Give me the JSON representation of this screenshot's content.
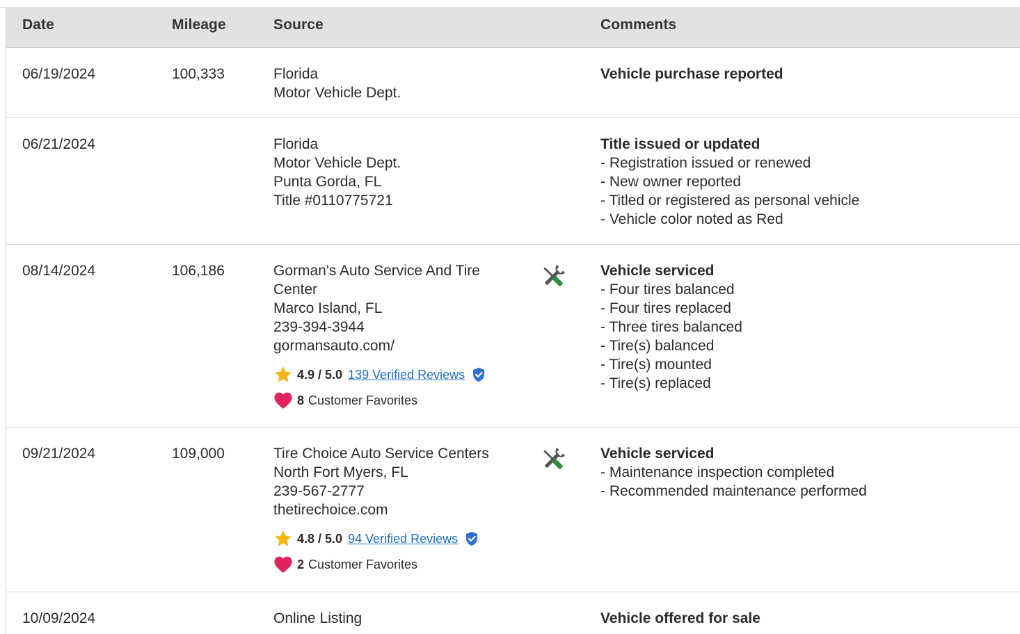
{
  "table": {
    "headers": {
      "date": "Date",
      "mileage": "Mileage",
      "source": "Source",
      "comments": "Comments"
    },
    "rows": [
      {
        "date": "06/19/2024",
        "mileage": "100,333",
        "source": [
          "Florida",
          "Motor Vehicle Dept."
        ],
        "comment_title": "Vehicle purchase reported",
        "comment_items": []
      },
      {
        "date": "06/21/2024",
        "mileage": "",
        "source": [
          "Florida",
          "Motor Vehicle Dept.",
          "Punta Gorda, FL",
          "Title #0110775721"
        ],
        "comment_title": "Title issued or updated",
        "comment_items": [
          "- Registration issued or renewed",
          "- New owner reported",
          "- Titled or registered as personal vehicle",
          "- Vehicle color noted as Red"
        ]
      },
      {
        "date": "08/14/2024",
        "mileage": "106,186",
        "source": [
          "Gorman's Auto Service And Tire",
          "Center",
          "Marco Island, FL",
          "239-394-3944",
          "gormansauto.com/"
        ],
        "rating": "4.9",
        "rating_sep": "/",
        "rating_max": "5.0",
        "reviews_link": "139 Verified Reviews",
        "favorites_count": "8",
        "favorites_label": "Customer Favorites",
        "icon": "service-tools-icon",
        "comment_title": "Vehicle serviced",
        "comment_items": [
          "- Four tires balanced",
          "- Four tires replaced",
          "- Three tires balanced",
          "- Tire(s) balanced",
          "- Tire(s) mounted",
          "- Tire(s) replaced"
        ]
      },
      {
        "date": "09/21/2024",
        "mileage": "109,000",
        "source": [
          "Tire Choice Auto Service Centers",
          "North Fort Myers, FL",
          "239-567-2777",
          "thetirechoice.com"
        ],
        "rating": "4.8",
        "rating_sep": "/",
        "rating_max": "5.0",
        "reviews_link": "94 Verified Reviews",
        "favorites_count": "2",
        "favorites_label": "Customer Favorites",
        "icon": "service-tools-icon",
        "comment_title": "Vehicle serviced",
        "comment_items": [
          "- Maintenance inspection completed",
          "- Recommended maintenance performed"
        ]
      },
      {
        "date": "10/09/2024",
        "mileage": "",
        "source": [
          "Online Listing"
        ],
        "comment_title": "Vehicle offered for sale",
        "comment_items": []
      }
    ]
  },
  "colors": {
    "header_bg": "#e2e2e2",
    "link": "#1f6fc5",
    "star": "#f6b819",
    "heart": "#e0245e",
    "verified_badge": "#2f6fd0",
    "wrench": "#555555",
    "screwdriver_handle": "#2e8b3e"
  }
}
